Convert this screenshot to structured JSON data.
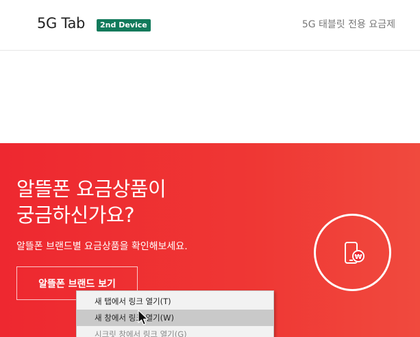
{
  "plan": {
    "name": "5G Tab",
    "badge": "2nd Device",
    "description": "5G 태블릿 전용 요금제"
  },
  "banner": {
    "title_line1": "알뜰폰 요금상품이",
    "title_line2": "궁금하신가요?",
    "subtitle": "알뜰폰 브랜드별 요금상품을 확인해보세요.",
    "button_label": "알뜰폰 브랜드 보기",
    "icon": "phone-won-icon",
    "color": "#ee2830"
  },
  "context_menu": {
    "items": [
      {
        "label": "새 탭에서 링크 열기(T)"
      },
      {
        "label": "새 창에서 링크 열기(W)",
        "highlighted": true
      },
      {
        "label": "시크릿 창에서 링크 열기(G)"
      }
    ]
  }
}
